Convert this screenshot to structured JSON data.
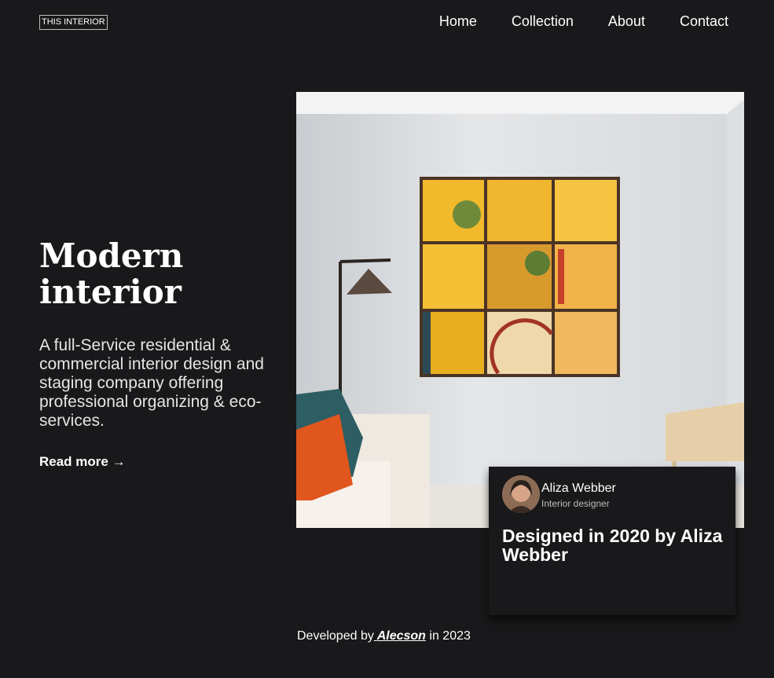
{
  "header": {
    "logo": "THIS INTERIOR",
    "nav": [
      "Home",
      "Collection",
      "About",
      "Contact"
    ]
  },
  "hero": {
    "title": "Modern interior",
    "description": "A full-Service residential & commercial interior design and staging company offering professional organizing & eco-services.",
    "read_more": "Read more",
    "read_more_icon": "arrow-right-icon"
  },
  "card": {
    "name": "Aliza Webber",
    "role": "Interior designer",
    "title": "Designed in 2020 by Aliza Webber"
  },
  "footer": {
    "prefix": "Developed by",
    "author": "Alecson",
    "suffix": "in 2023"
  },
  "colors": {
    "background": "#19181a",
    "text": "#ffffff"
  }
}
